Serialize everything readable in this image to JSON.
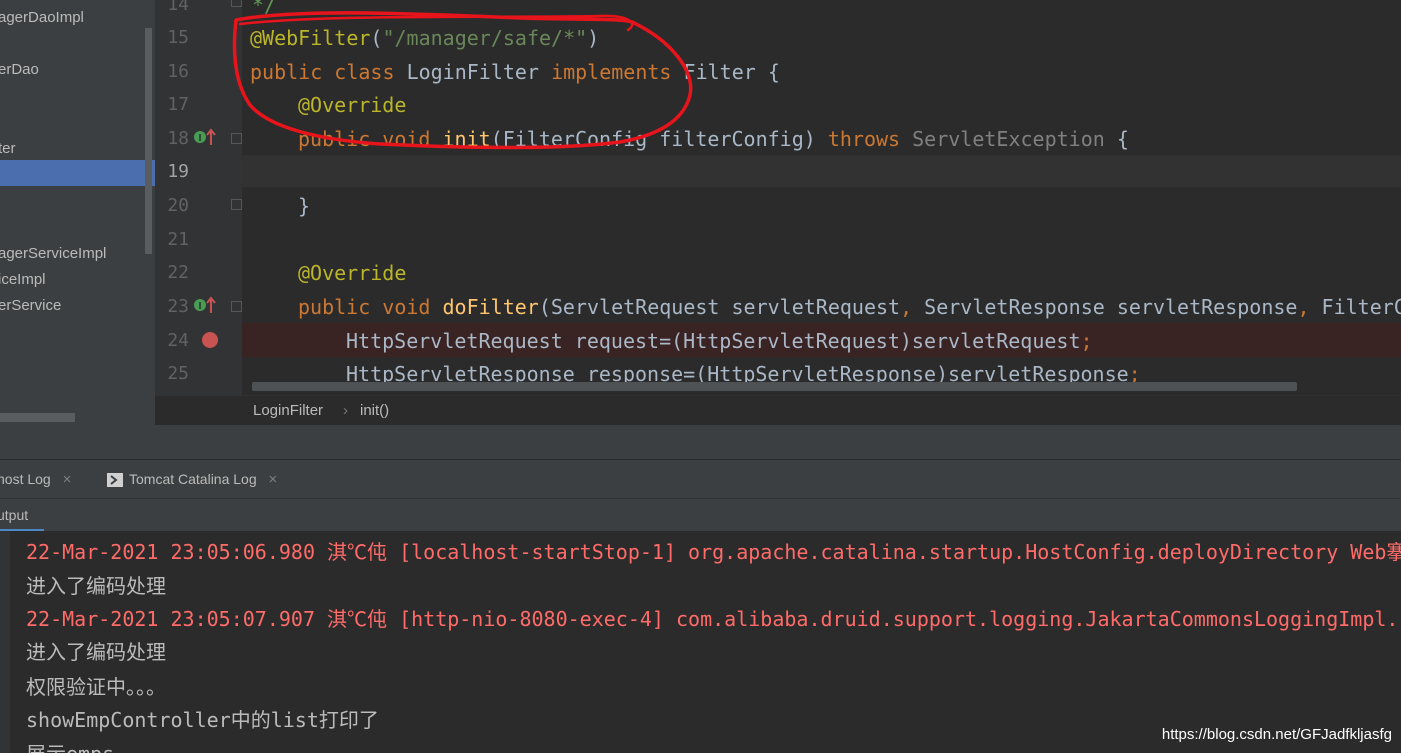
{
  "project_tree": {
    "items": [
      "agerDaoImpl",
      "erDao",
      "ter",
      "agerServiceImpl",
      "iceImpl",
      "erService"
    ]
  },
  "gutter": {
    "line_numbers": [
      "14",
      "15",
      "16",
      "17",
      "18",
      "19",
      "20",
      "21",
      "22",
      "23",
      "24",
      "25"
    ]
  },
  "code": {
    "line14": "*/",
    "line15_annotation": "@WebFilter",
    "line15_open": "(",
    "line15_string": "\"/manager/safe/*\"",
    "line15_close": ")",
    "line16_public": "public",
    "line16_class": "class",
    "line16_name": "LoginFilter",
    "line16_implements": "implements",
    "line16_iface": "Filter {",
    "line17_annotation": "@Override",
    "line18_public": "public",
    "line18_void": "void",
    "line18_method": "init",
    "line18_params": "(FilterConfig filterConfig) ",
    "line18_throws": "throws",
    "line18_exception": "ServletException",
    "line18_brace": " {",
    "line20_brace": "}",
    "line22_annotation": "@Override",
    "line23_public": "public",
    "line23_void": "void",
    "line23_method": "doFilter",
    "line23_p1": "(ServletRequest servletRequest",
    "line23_p2": "ServletResponse servletResponse",
    "line23_p3": "FilterC",
    "line24_text": "HttpServletRequest request=(HttpServletRequest)servletRequest",
    "line25_text": "HttpServletResponse response=(HttpServletResponse)servletResponse",
    "semicolon": ";",
    "comma": ", "
  },
  "breadcrumb": {
    "class_name": "LoginFilter",
    "separator": "›",
    "method": "init()"
  },
  "tabs": [
    {
      "label": "host Log",
      "close": "×"
    },
    {
      "label": "Tomcat Catalina Log",
      "close": "×"
    }
  ],
  "output_tab": {
    "label": "utput"
  },
  "console": {
    "lines": [
      "22-Mar-2021 23:05:06.980 淇℃伅 [localhost-startStop-1] org.apache.catalina.startup.HostConfig.deployDirectory Web搴",
      "进入了编码处理",
      "22-Mar-2021 23:05:07.907 淇℃伅 [http-nio-8080-exec-4] com.alibaba.druid.support.logging.JakartaCommonsLoggingImpl.",
      "进入了编码处理",
      "权限验证中。。。",
      "showEmpController中的list打印了",
      "展示emps"
    ]
  },
  "watermark": "https://blog.csdn.net/GFJadfkljasfg",
  "colors": {
    "keyword": "#cc7832",
    "annotation": "#bbb529",
    "string": "#6a8759",
    "method": "#ffc66d",
    "console_error": "#ff6b68",
    "selection": "#4b6eaf",
    "breakpoint": "#c75450",
    "override_marker": "#499c54",
    "markup_pen": "#e8141b"
  }
}
